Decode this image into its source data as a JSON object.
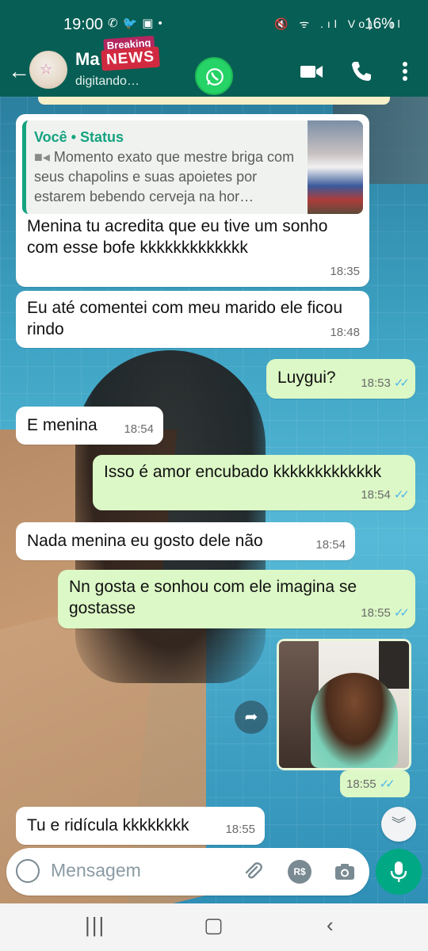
{
  "status_bar": {
    "time": "19:00",
    "left_icons": [
      "whatsapp-icon",
      "twitter-icon",
      "badge-icon",
      "dot-icon"
    ],
    "right_icons_text": "🔇 ᯤ .ıl Vo) .ıl",
    "battery": "16%"
  },
  "header": {
    "contact_name": "Ma",
    "subtitle": "digitando…",
    "overlay_badge_top": "Breaking",
    "overlay_badge_bottom": "NEWS",
    "icons": [
      "back-arrow-icon",
      "video-call-icon",
      "phone-icon",
      "more-vert-icon"
    ]
  },
  "messages": [
    {
      "direction": "in",
      "quoted": {
        "author": "Você • Status",
        "text": "Momento exato que mestre briga com seus chapolins e suas apoietes por estarem bebendo cerveja na hor…"
      },
      "text": "Menina tu acredita que eu tive um sonho com esse bofe kkkkkkkkkkkkk",
      "time": "18:35"
    },
    {
      "direction": "in",
      "text": "Eu até comentei com meu marido ele ficou rindo",
      "time": "18:48"
    },
    {
      "direction": "out",
      "text": "Luygui?",
      "time": "18:53"
    },
    {
      "direction": "in",
      "text": "E menina",
      "time": "18:54"
    },
    {
      "direction": "out",
      "text": "Isso é amor encubado kkkkkkkkkkkkk",
      "time": "18:54"
    },
    {
      "direction": "in",
      "text": "Nada menina eu gosto dele não",
      "time": "18:54"
    },
    {
      "direction": "out",
      "text": "Nn gosta e sonhou com ele imagina se gostasse",
      "time": "18:55"
    },
    {
      "direction": "out",
      "type": "image",
      "time": "18:55"
    },
    {
      "direction": "in",
      "text": "Tu e ridícula kkkkkkkk",
      "time": "18:55"
    }
  ],
  "input": {
    "placeholder": "Mensagem",
    "icons": [
      "emoji-icon",
      "attach-icon",
      "payment-icon",
      "camera-icon",
      "mic-icon"
    ],
    "payment_label": "R$"
  },
  "nav": {
    "icons": [
      "recents-icon",
      "home-icon",
      "back-icon"
    ]
  },
  "colors": {
    "header": "#075e54",
    "out_bubble": "#dcf8c6",
    "in_bubble": "#ffffff",
    "accent": "#00a884",
    "read_ticks": "#4fb6ec"
  }
}
